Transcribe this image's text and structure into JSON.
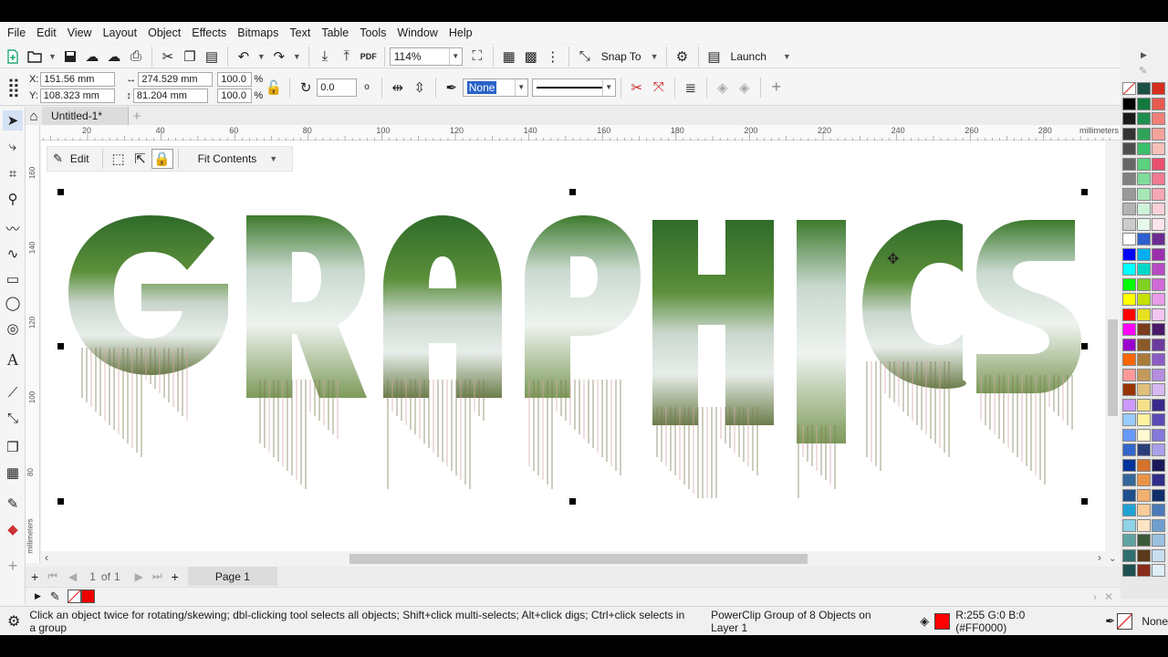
{
  "menu": [
    "File",
    "Edit",
    "View",
    "Layout",
    "Object",
    "Effects",
    "Bitmaps",
    "Text",
    "Table",
    "Tools",
    "Window",
    "Help"
  ],
  "toolbar": {
    "zoom": "114%",
    "snap_label": "Snap To",
    "launch_label": "Launch"
  },
  "propbar": {
    "x_label": "X:",
    "x_value": "151.56 mm",
    "y_label": "Y:",
    "y_value": "108.323 mm",
    "w_value": "274.529 mm",
    "h_value": "81.204 mm",
    "scale_w": "100.0",
    "scale_h": "100.0",
    "percent": "%",
    "rotation": "0.0",
    "degree": "o",
    "outline_width": "None"
  },
  "document": {
    "tab_title": "Untitled-1*",
    "ruler_unit": "millimeters",
    "ruler_ticks": [
      "20",
      "40",
      "60",
      "80",
      "100",
      "120",
      "140",
      "160",
      "180",
      "200",
      "220",
      "240",
      "260",
      "280"
    ],
    "vruler_ticks": [
      "160",
      "140",
      "120",
      "100",
      "80"
    ],
    "vruler_unit": "millimeters"
  },
  "floating_toolbar": {
    "edit_label": "Edit",
    "fit_label": "Fit Contents"
  },
  "artwork": {
    "letters": [
      "G",
      "R",
      "A",
      "P",
      "H",
      "I",
      "C",
      "S"
    ]
  },
  "pages": {
    "current": "1",
    "of_label": "of",
    "total": "1",
    "page_tab": "Page 1"
  },
  "status": {
    "hint": "Click an object twice for rotating/skewing; dbl-clicking tool selects all objects; Shift+click multi-selects; Alt+click digs; Ctrl+click selects in a group",
    "object_info": "PowerClip Group of 8 Objects on Layer 1",
    "fill_info": "R:255 G:0 B:0 (#FF0000)",
    "outline_info": "None",
    "fill_color": "#FF0000"
  },
  "palette_colors": [
    [
      "#ffffff",
      "#1d4f44",
      "#d62d1f"
    ],
    [
      "#000000",
      "#127a3e",
      "#e65a4f"
    ],
    [
      "#1a1a1a",
      "#1e8f4e",
      "#f08077"
    ],
    [
      "#333333",
      "#2fa35a",
      "#f5a29a"
    ],
    [
      "#4d4d4d",
      "#3bbf6a",
      "#f7c0bb"
    ],
    [
      "#666666",
      "#5ad27e",
      "#e8506e"
    ],
    [
      "#808080",
      "#7fdc9a",
      "#f07a90"
    ],
    [
      "#999999",
      "#a6e7b6",
      "#f6a6b5"
    ],
    [
      "#b3b3b3",
      "#cff3d8",
      "#fbd0d8"
    ],
    [
      "#cccccc",
      "#e4f9ea",
      "#fbe5ea"
    ],
    [
      "#ffffff",
      "#2c5fd0",
      "#6a2c91"
    ],
    [
      "#0000ff",
      "#00aeef",
      "#9b2fae"
    ],
    [
      "#00ffff",
      "#00d7c9",
      "#b84bc4"
    ],
    [
      "#00ff00",
      "#7ed321",
      "#d06ad6"
    ],
    [
      "#ffff00",
      "#c4e000",
      "#e89be8"
    ],
    [
      "#ff0000",
      "#e8e020",
      "#f2c4f0"
    ],
    [
      "#ff00ff",
      "#7a3b1e",
      "#4b1a6a"
    ],
    [
      "#9900cc",
      "#8a5a2b",
      "#6c3a9e"
    ],
    [
      "#ff6600",
      "#a97b3b",
      "#8c5cc4"
    ],
    [
      "#ff9999",
      "#c49a5a",
      "#b58ee0"
    ],
    [
      "#993300",
      "#e0c07a",
      "#d6b8f2"
    ],
    [
      "#cc99ff",
      "#f5e08a",
      "#3a2a8a"
    ],
    [
      "#99ccff",
      "#fff3a0",
      "#5c4ab4"
    ],
    [
      "#6699ff",
      "#fffbd0",
      "#8478d8"
    ],
    [
      "#3366cc",
      "#2a3f7a",
      "#a9a0ea"
    ],
    [
      "#003399",
      "#d4732a",
      "#1a1a5a"
    ],
    [
      "#336699",
      "#e89448",
      "#2f2f8a"
    ],
    [
      "#1f4f8f",
      "#f2b070",
      "#0f2f6a"
    ],
    [
      "#1fa3d6",
      "#f8cc98",
      "#4a7ab8"
    ],
    [
      "#8fd3e8",
      "#fce4c4",
      "#6f9fcf"
    ],
    [
      "#5fa3a3",
      "#3a5a3a",
      "#9bc0e0"
    ],
    [
      "#2f6f6f",
      "#5a3a1a",
      "#c8dff0"
    ],
    [
      "#1f4f4f",
      "#8a2a1a",
      "#e0eef8"
    ]
  ]
}
